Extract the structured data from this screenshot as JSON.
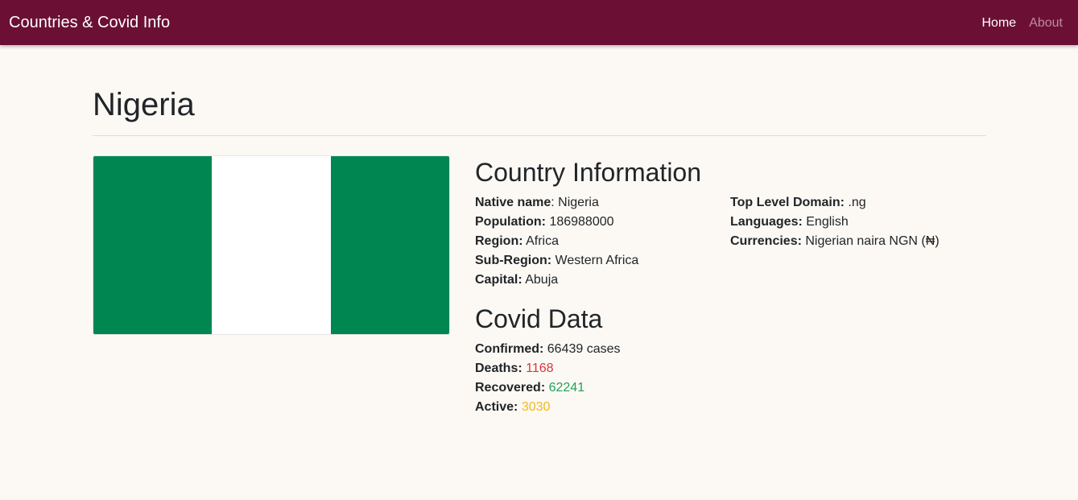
{
  "navbar": {
    "brand": "Countries & Covid Info",
    "links": [
      {
        "label": "Home"
      },
      {
        "label": "About"
      }
    ]
  },
  "page": {
    "title": "Nigeria"
  },
  "flag": {
    "colors": [
      "#008751",
      "#ffffff",
      "#008751"
    ]
  },
  "country_info": {
    "title": "Country Information",
    "native_name": {
      "label": "Native name",
      "value": "Nigeria"
    },
    "population": {
      "label": "Population:",
      "value": "186988000"
    },
    "region": {
      "label": "Region:",
      "value": "Africa"
    },
    "sub_region": {
      "label": "Sub-Region:",
      "value": "Western Africa"
    },
    "capital": {
      "label": "Capital:",
      "value": "Abuja"
    },
    "top_level_domain": {
      "label": "Top Level Domain:",
      "value": ".ng"
    },
    "languages": {
      "label": "Languages:",
      "value": "English"
    },
    "currencies": {
      "label": "Currencies:",
      "value": "Nigerian naira NGN (₦)"
    }
  },
  "covid": {
    "title": "Covid Data",
    "confirmed": {
      "label": "Confirmed:",
      "value": "66439 cases"
    },
    "deaths": {
      "label": "Deaths:",
      "value": "1168"
    },
    "recovered": {
      "label": "Recovered:",
      "value": "62241"
    },
    "active": {
      "label": "Active:",
      "value": "3030"
    }
  },
  "colors": {
    "navbar": "#6b1034",
    "background": "#fcf9f4",
    "deaths": "#d9363e",
    "recovered": "#22a05a",
    "active": "#f2b81e"
  }
}
